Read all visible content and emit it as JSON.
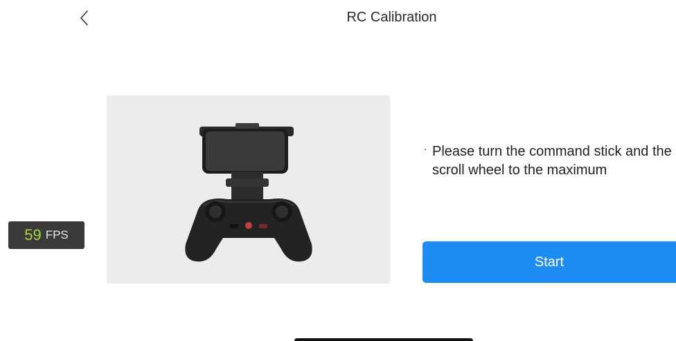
{
  "header": {
    "title": "RC Calibration",
    "back_icon": "chevron-left-icon"
  },
  "overlay": {
    "fps_value": "59",
    "fps_unit": "FPS"
  },
  "main": {
    "illustration_icon": "remote-controller-with-phone",
    "instruction_bullet": "·",
    "instruction_text": "Please turn the command stick and the scroll wheel to the maximum",
    "start_label": "Start"
  },
  "colors": {
    "accent": "#1f8cf4",
    "fps_value": "#a6d63a",
    "fps_bg": "#3a3a3a"
  }
}
